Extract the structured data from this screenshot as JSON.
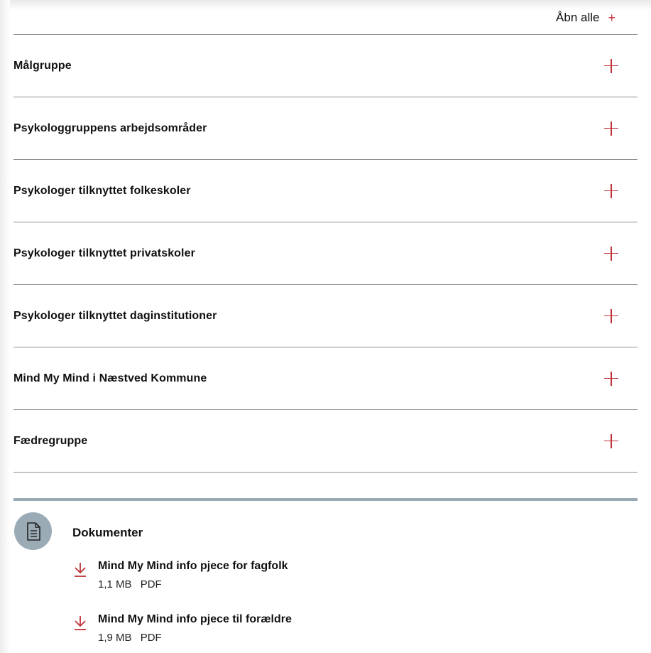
{
  "expand_all": {
    "label": "Åbn alle",
    "icon": "+"
  },
  "accordion": {
    "items": [
      {
        "title": "Målgruppe"
      },
      {
        "title": "Psykologgruppens arbejdsområder"
      },
      {
        "title": "Psykologer tilknyttet folkeskoler"
      },
      {
        "title": "Psykologer tilknyttet privatskoler"
      },
      {
        "title": "Psykologer tilknyttet daginstitutioner"
      },
      {
        "title": "Mind My Mind i Næstved Kommune"
      },
      {
        "title": "Fædregruppe"
      }
    ]
  },
  "documents": {
    "heading": "Dokumenter",
    "icon": "document-icon",
    "items": [
      {
        "title": "Mind My Mind info pjece for fagfolk",
        "size": "1,1 MB",
        "type": "PDF",
        "icon": "download-icon"
      },
      {
        "title": "Mind My Mind info pjece til forældre",
        "size": "1,9 MB",
        "type": "PDF",
        "icon": "download-icon"
      }
    ]
  },
  "colors": {
    "accent": "#c0333a",
    "divider": "#8f8f8f",
    "doc_badge": "#9aabb6"
  }
}
